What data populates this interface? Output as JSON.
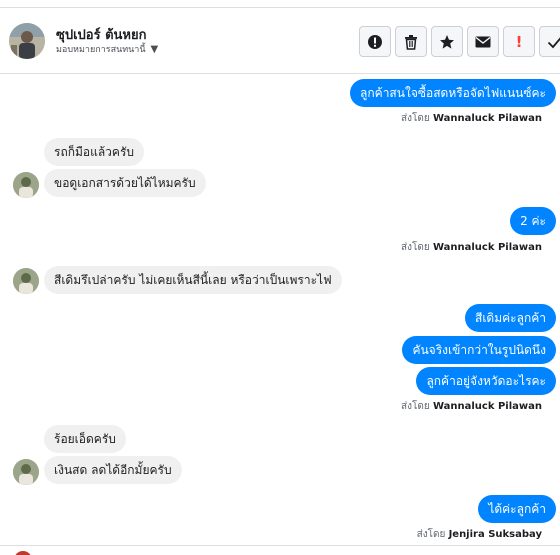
{
  "contact": {
    "name": "ซุปเปอร์ ต้นหยก",
    "subtitle": "มอบหมายการสนทนานี้"
  },
  "actions": [
    {
      "name": "mark-important-button",
      "icon": "alert-circle-icon"
    },
    {
      "name": "delete-button",
      "icon": "trash-icon"
    },
    {
      "name": "star-button",
      "icon": "star-icon"
    },
    {
      "name": "mark-unread-button",
      "icon": "envelope-icon"
    },
    {
      "name": "spam-button",
      "icon": "exclamation-icon",
      "label": "!"
    },
    {
      "name": "done-button",
      "icon": "check-icon"
    }
  ],
  "sent_by_prefix": "ส่งโดย",
  "messages": {
    "m1": "ลูกค้าสนใจซื้อสดหรือจัดไฟแนนซ์คะ",
    "m1_sender": "Wannaluck Pilawan",
    "m2": "รถก็มือแล้วครับ",
    "m3": "ขอดูเอกสารด้วยได้ไหมครับ",
    "m4": "2 ค่ะ",
    "m4_sender": "Wannaluck Pilawan",
    "m5": "สีเดิมรึเปล่าครับ ไม่เคยเห็นสีนี้เลย หรือว่าเป็นเพราะไฟ",
    "m6": "สีเดิมค่ะลูกค้า",
    "m7": "คันจริงเข้ากว่าในรูปนิดนึง",
    "m8": "ลูกค้าอยู่จังหวัดอะไรคะ",
    "m8_sender": "Wannaluck Pilawan",
    "m9": "ร้อยเอ็ดครับ",
    "m10": "เงินสด ลดได้อีกมั้ยครับ",
    "m11": "ได้ค่ะลูกค้า",
    "m11_sender": "Jenjira Suksabay"
  },
  "colors": {
    "outgoing": "#0084ff",
    "incoming": "#f1f0f0",
    "border": "#dddfe2",
    "alert": "#fa3e3e"
  }
}
